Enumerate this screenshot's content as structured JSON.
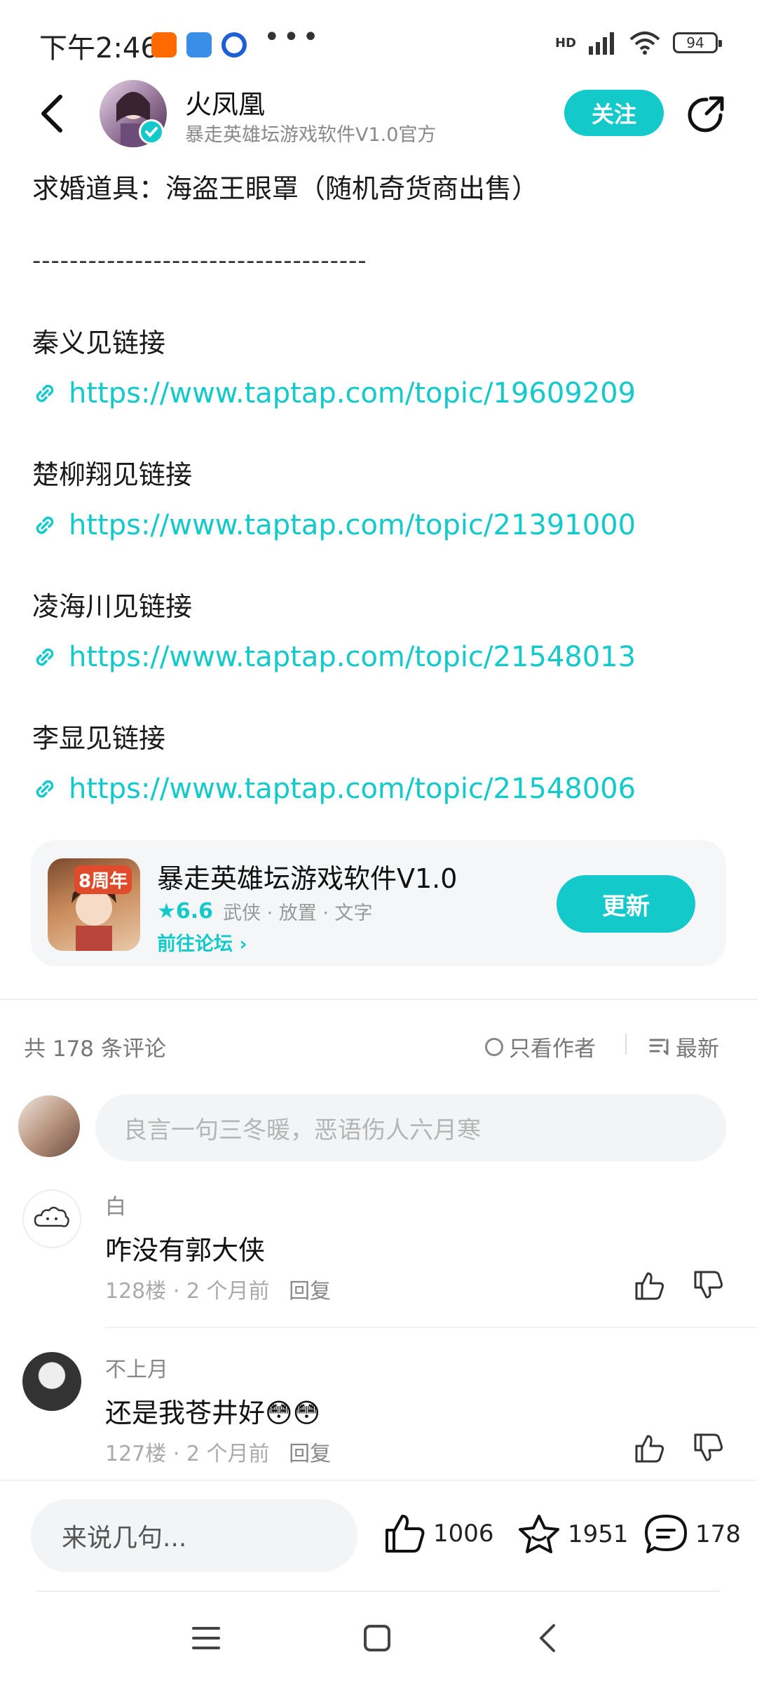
{
  "status_bar": {
    "time": "下午2:46",
    "battery": "94",
    "network": "HD"
  },
  "header": {
    "author_name": "火凤凰",
    "author_subtitle": "暴走英雄坛游戏软件V1.0官方",
    "follow_label": "关注",
    "icons": [
      "back-icon",
      "verified-icon",
      "share-icon"
    ]
  },
  "post": {
    "proposal_item_line": "求婚道具：海盗王眼罩（随机奇货商出售）",
    "separator": "------------------------------------",
    "entries": [
      {
        "label": "秦义见链接",
        "url": "https://www.taptap.com/topic/19609209"
      },
      {
        "label": "楚柳翔见链接",
        "url": "https://www.taptap.com/topic/21391000"
      },
      {
        "label": "凌海川见链接",
        "url": "https://www.taptap.com/topic/21548013"
      },
      {
        "label": "李显见链接",
        "url": "https://www.taptap.com/topic/21548006"
      }
    ]
  },
  "app_card": {
    "icon_badge": "8周年",
    "title": "暴走英雄坛游戏软件V1.0",
    "rating": "6.6",
    "tags": "武侠 · 放置 · 文字",
    "forum_link": "前往论坛",
    "update_label": "更新"
  },
  "comments_section": {
    "count_text": "共 178 条评论",
    "only_author": "只看作者",
    "sort_label": "最新",
    "input_placeholder": "良言一句三冬暖，恶语伤人六月寒",
    "comments": [
      {
        "user": "白",
        "text": "咋没有郭大侠",
        "floor": "128楼",
        "time": "2 个月前",
        "reply": "回复"
      },
      {
        "user": "不上月",
        "text": "还是我苍井好😳😳",
        "floor": "127楼",
        "time": "2 个月前",
        "reply": "回复"
      }
    ]
  },
  "bottom_bar": {
    "say_placeholder": "来说几句...",
    "likes": "1006",
    "favorites": "1951",
    "comments": "178"
  },
  "colors": {
    "accent": "#14c9c9",
    "muted": "#8a8a8a",
    "card_bg": "#f4f6f7"
  }
}
